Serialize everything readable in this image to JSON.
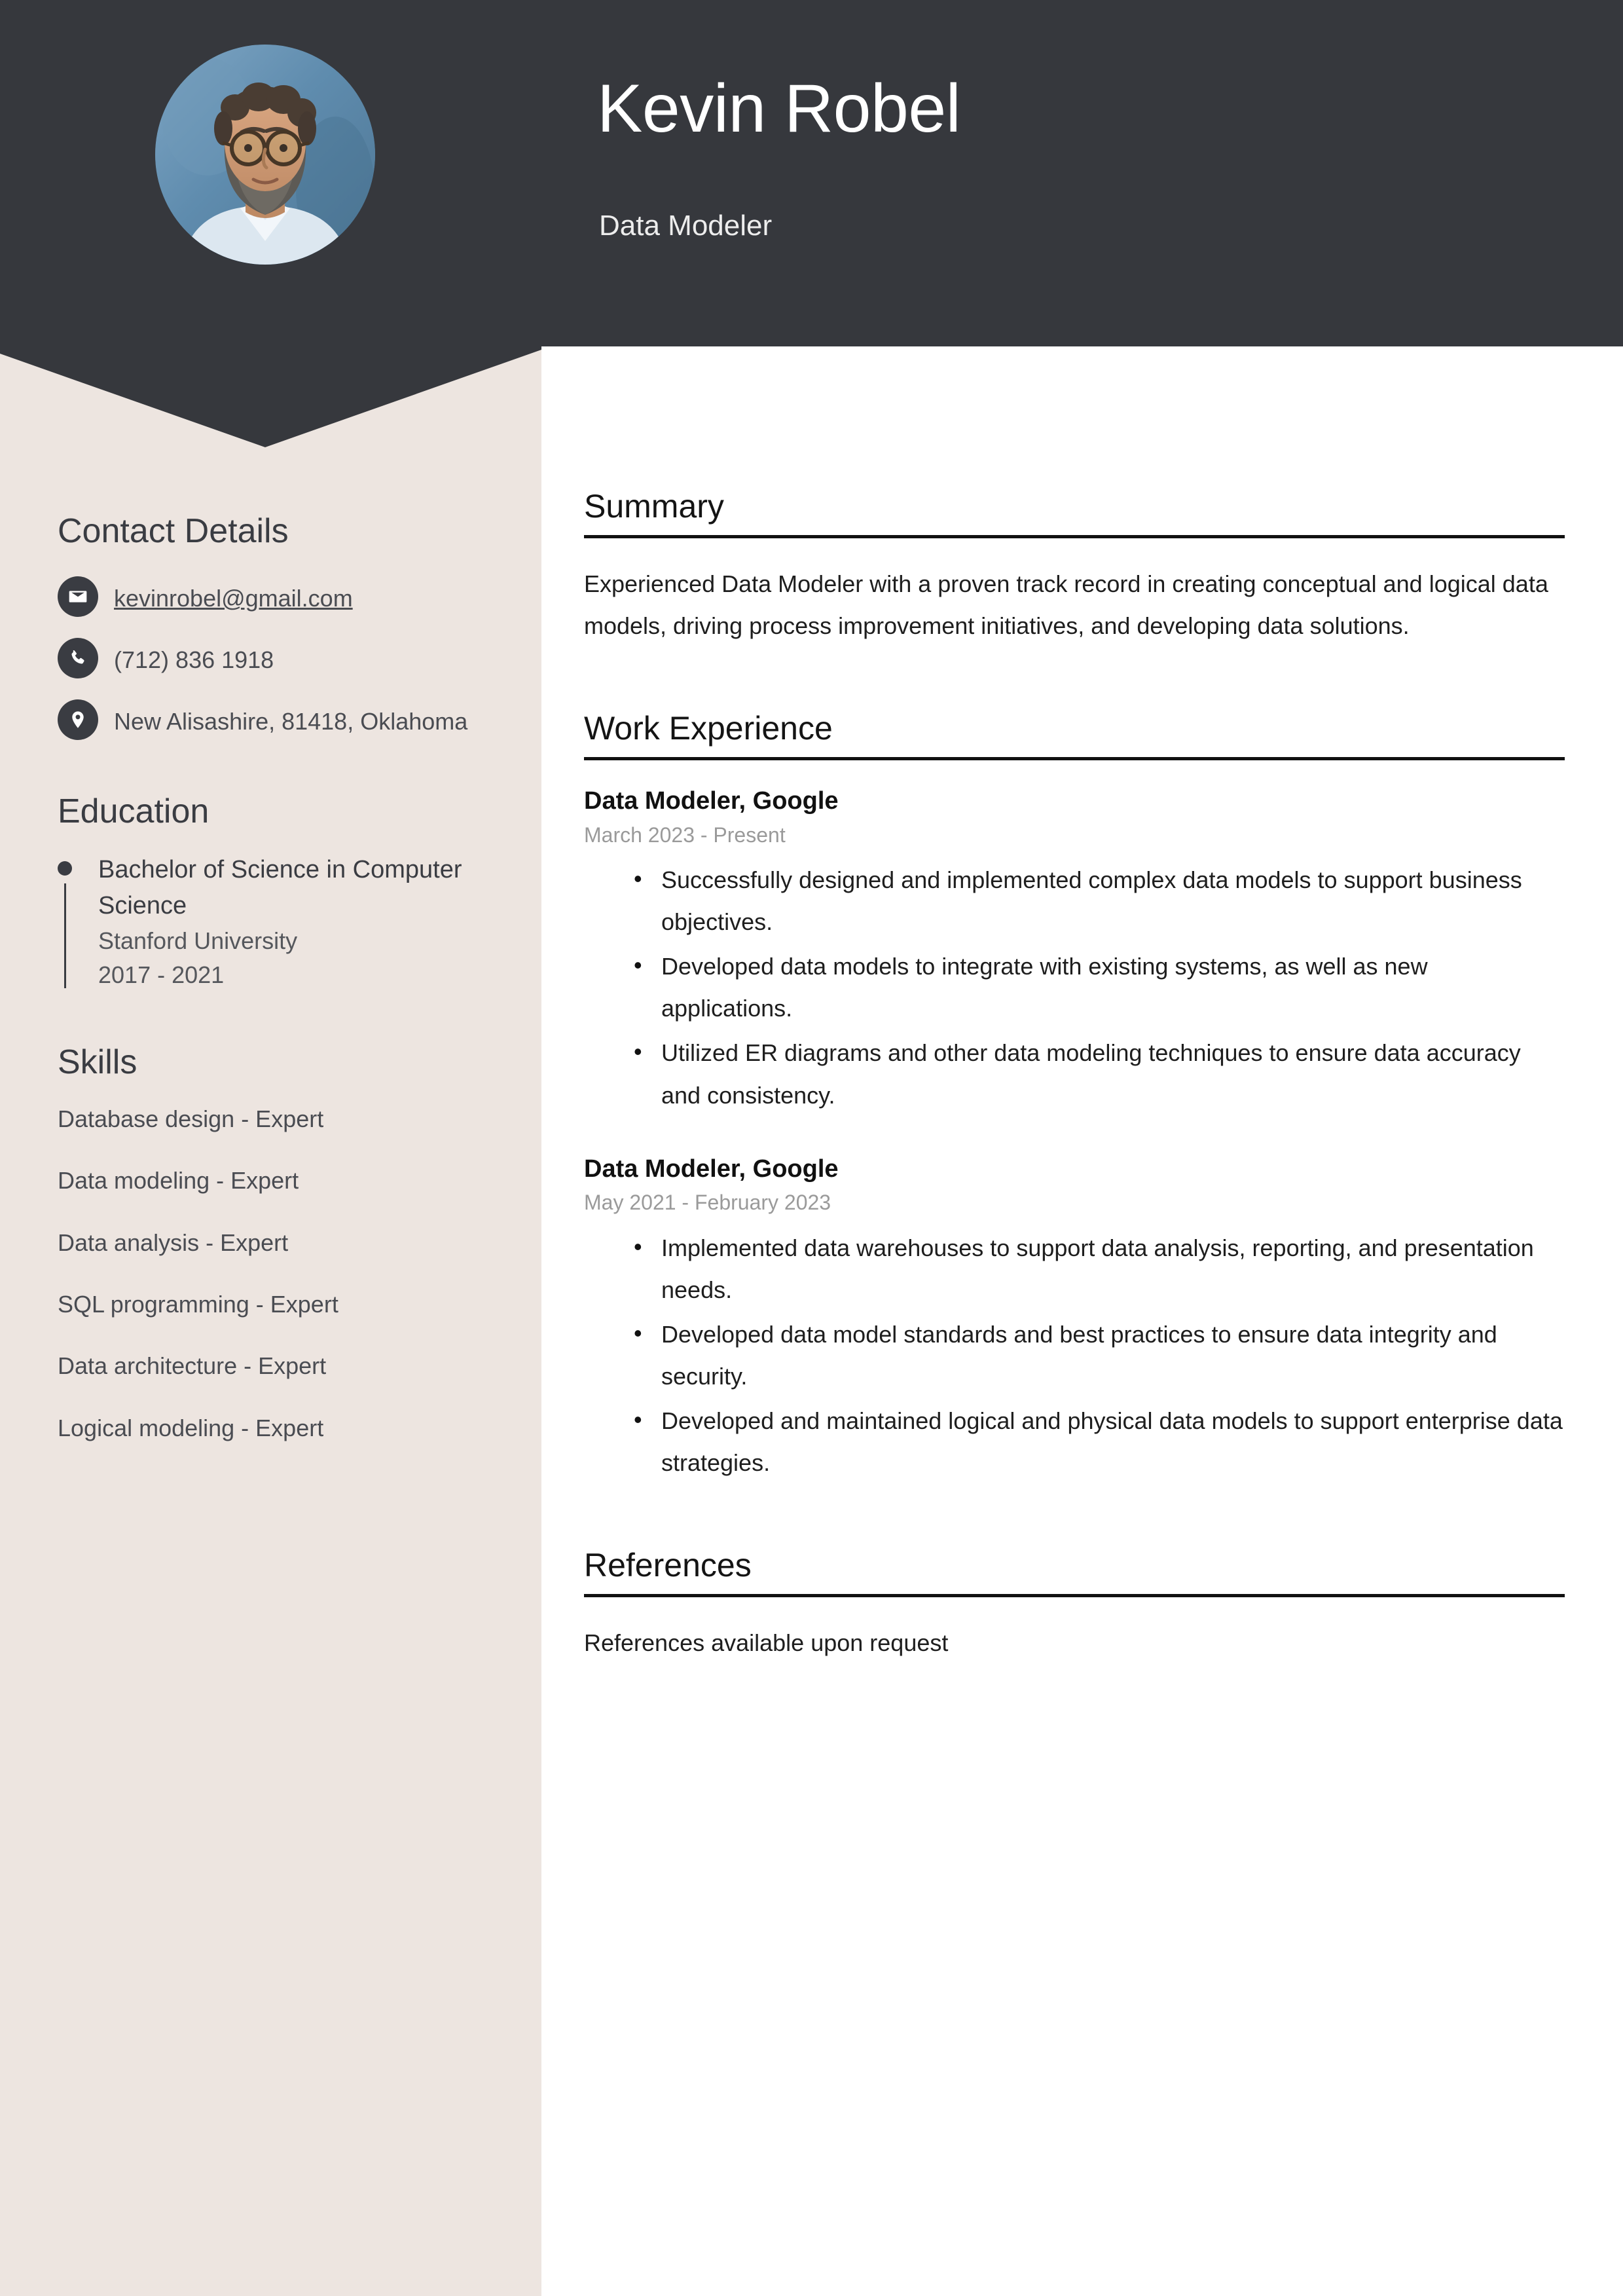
{
  "theme": {
    "header_bg": "#36383D",
    "sidebar_bg": "#EDE5E0",
    "main_bg": "#FFFFFF",
    "accent_dark": "#3A3C42",
    "muted_text": "#9A9A9A"
  },
  "header": {
    "name": "Kevin Robel",
    "role": "Data Modeler",
    "avatar_alt": "profile-photo"
  },
  "sidebar": {
    "contact": {
      "heading": "Contact Details",
      "items": [
        {
          "icon": "envelope-icon",
          "value": "kevinrobel@gmail.com",
          "type": "email"
        },
        {
          "icon": "phone-icon",
          "value": "(712) 836 1918",
          "type": "phone"
        },
        {
          "icon": "location-pin-icon",
          "value": "New Alisashire, 81418, Oklahoma",
          "type": "address"
        }
      ]
    },
    "education": {
      "heading": "Education",
      "items": [
        {
          "degree": "Bachelor of Science in Computer Science",
          "school": "Stanford University",
          "dates": "2017 - 2021"
        }
      ]
    },
    "skills": {
      "heading": "Skills",
      "items": [
        "Database design - Expert",
        "Data modeling - Expert",
        "Data analysis - Expert",
        "SQL programming - Expert",
        "Data architecture - Expert",
        "Logical modeling - Expert"
      ]
    }
  },
  "main": {
    "summary": {
      "heading": "Summary",
      "text": "Experienced Data Modeler with a proven track record in creating conceptual and logical data models, driving process improvement initiatives, and developing data solutions."
    },
    "work_experience": {
      "heading": "Work Experience",
      "jobs": [
        {
          "title": "Data Modeler, Google",
          "dates": "March 2023 - Present",
          "bullets": [
            "Successfully designed and implemented complex data models to support business objectives.",
            "Developed data models to integrate with existing systems, as well as new applications.",
            "Utilized ER diagrams and other data modeling techniques to ensure data accuracy and consistency."
          ]
        },
        {
          "title": "Data Modeler, Google",
          "dates": "May 2021 - February 2023",
          "bullets": [
            "Implemented data warehouses to support data analysis, reporting, and presentation needs.",
            "Developed data model standards and best practices to ensure data integrity and security.",
            "Developed and maintained logical and physical data models to support enterprise data strategies."
          ]
        }
      ]
    },
    "references": {
      "heading": "References",
      "text": "References available upon request"
    }
  }
}
